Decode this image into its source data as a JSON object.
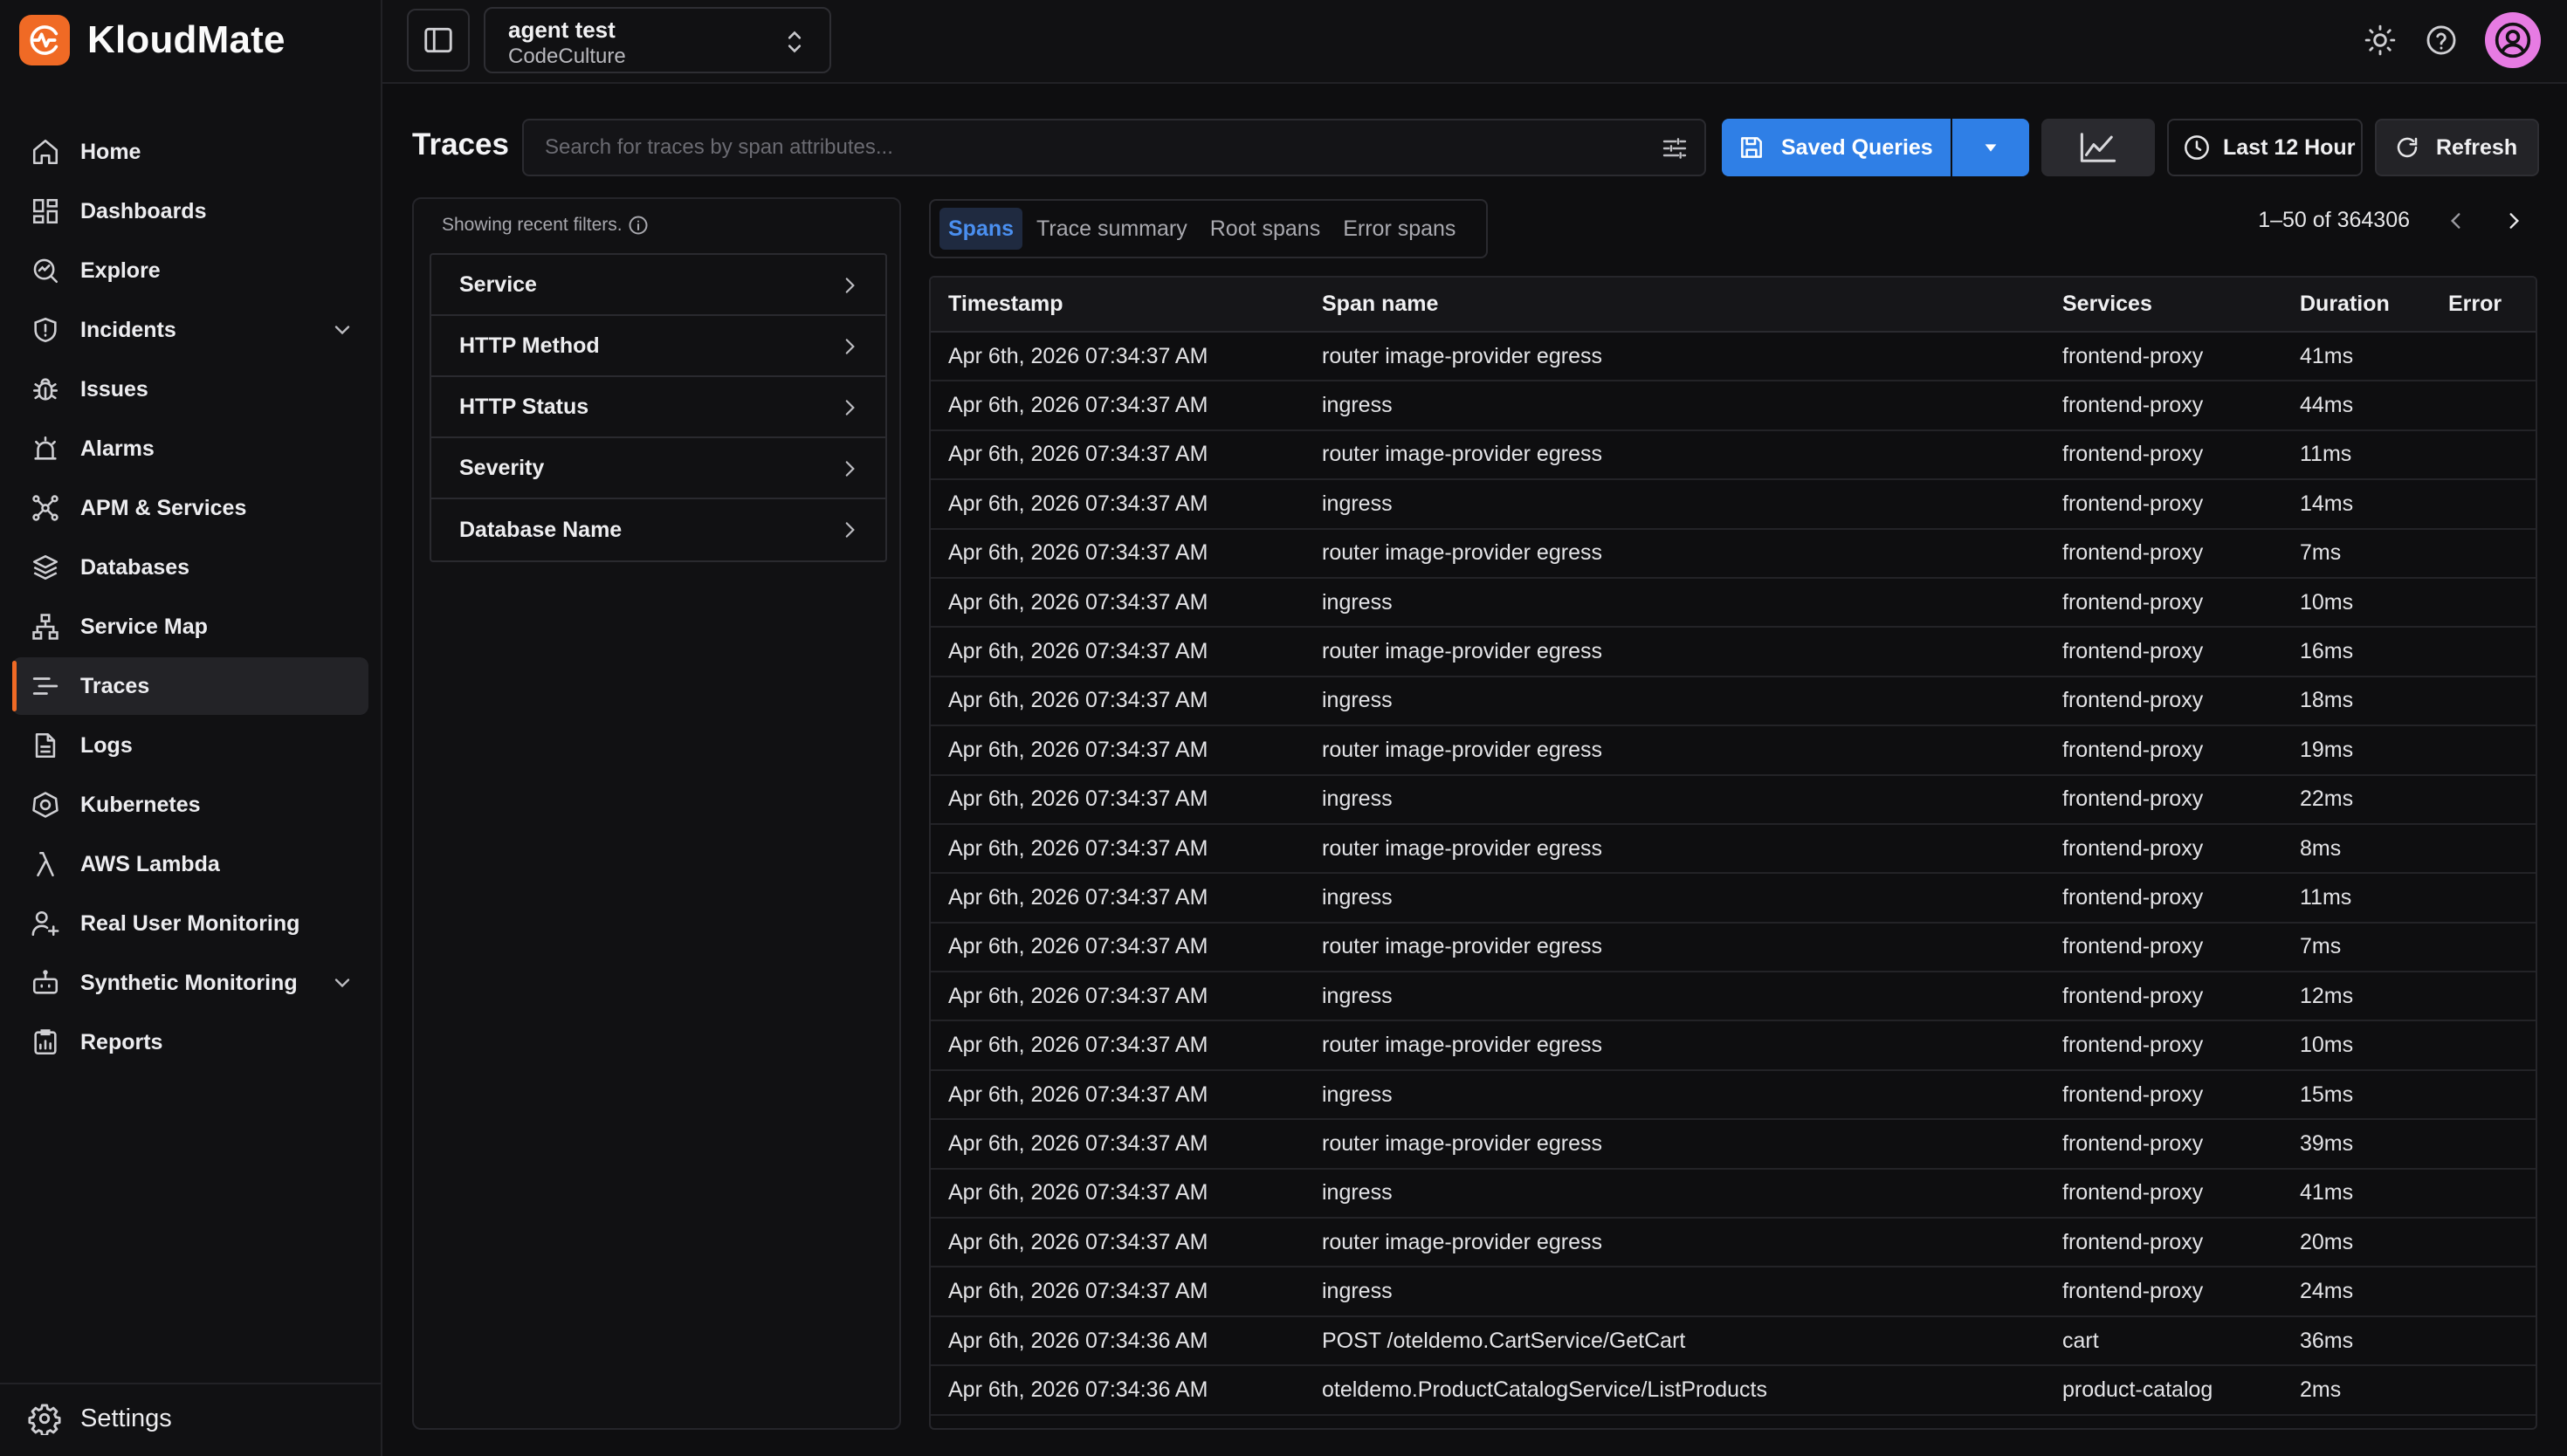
{
  "brand": {
    "name": "KloudMate",
    "accent": "#f06a25"
  },
  "sidebar": {
    "items": [
      {
        "label": "Home",
        "icon": "home-icon"
      },
      {
        "label": "Dashboards",
        "icon": "dashboard-icon"
      },
      {
        "label": "Explore",
        "icon": "explore-icon"
      },
      {
        "label": "Incidents",
        "icon": "shield-icon",
        "expandable": true
      },
      {
        "label": "Issues",
        "icon": "bug-icon"
      },
      {
        "label": "Alarms",
        "icon": "alarm-icon"
      },
      {
        "label": "APM & Services",
        "icon": "apm-icon"
      },
      {
        "label": "Databases",
        "icon": "database-icon"
      },
      {
        "label": "Service Map",
        "icon": "service-map-icon"
      },
      {
        "label": "Traces",
        "icon": "traces-icon",
        "active": true
      },
      {
        "label": "Logs",
        "icon": "logs-icon"
      },
      {
        "label": "Kubernetes",
        "icon": "kubernetes-icon"
      },
      {
        "label": "AWS Lambda",
        "icon": "lambda-icon"
      },
      {
        "label": "Real User Monitoring",
        "icon": "user-monitor-icon"
      },
      {
        "label": "Synthetic Monitoring",
        "icon": "robot-icon",
        "expandable": true
      },
      {
        "label": "Reports",
        "icon": "reports-icon"
      }
    ],
    "settings_label": "Settings"
  },
  "topbar": {
    "workspace_name": "agent test",
    "workspace_org": "CodeCulture"
  },
  "toolbar": {
    "title": "Traces",
    "search_placeholder": "Search for traces by span attributes...",
    "saved_queries_label": "Saved Queries",
    "time_range_label": "Last 12 Hour",
    "refresh_label": "Refresh",
    "primary_color": "#2f7fe6"
  },
  "filters": {
    "note": "Showing recent filters.",
    "items": [
      "Service",
      "HTTP Method",
      "HTTP Status",
      "Severity",
      "Database Name"
    ]
  },
  "results": {
    "tabs": [
      {
        "label": "Spans",
        "active": true
      },
      {
        "label": "Trace summary"
      },
      {
        "label": "Root spans"
      },
      {
        "label": "Error spans"
      }
    ],
    "pagination": "1–50 of 364306",
    "columns": [
      "Timestamp",
      "Span name",
      "Services",
      "Duration",
      "Error"
    ],
    "rows": [
      [
        "Apr 6th, 2026 07:34:37 AM",
        "router image-provider egress",
        "frontend-proxy",
        "41ms",
        ""
      ],
      [
        "Apr 6th, 2026 07:34:37 AM",
        "ingress",
        "frontend-proxy",
        "44ms",
        ""
      ],
      [
        "Apr 6th, 2026 07:34:37 AM",
        "router image-provider egress",
        "frontend-proxy",
        "11ms",
        ""
      ],
      [
        "Apr 6th, 2026 07:34:37 AM",
        "ingress",
        "frontend-proxy",
        "14ms",
        ""
      ],
      [
        "Apr 6th, 2026 07:34:37 AM",
        "router image-provider egress",
        "frontend-proxy",
        "7ms",
        ""
      ],
      [
        "Apr 6th, 2026 07:34:37 AM",
        "ingress",
        "frontend-proxy",
        "10ms",
        ""
      ],
      [
        "Apr 6th, 2026 07:34:37 AM",
        "router image-provider egress",
        "frontend-proxy",
        "16ms",
        ""
      ],
      [
        "Apr 6th, 2026 07:34:37 AM",
        "ingress",
        "frontend-proxy",
        "18ms",
        ""
      ],
      [
        "Apr 6th, 2026 07:34:37 AM",
        "router image-provider egress",
        "frontend-proxy",
        "19ms",
        ""
      ],
      [
        "Apr 6th, 2026 07:34:37 AM",
        "ingress",
        "frontend-proxy",
        "22ms",
        ""
      ],
      [
        "Apr 6th, 2026 07:34:37 AM",
        "router image-provider egress",
        "frontend-proxy",
        "8ms",
        ""
      ],
      [
        "Apr 6th, 2026 07:34:37 AM",
        "ingress",
        "frontend-proxy",
        "11ms",
        ""
      ],
      [
        "Apr 6th, 2026 07:34:37 AM",
        "router image-provider egress",
        "frontend-proxy",
        "7ms",
        ""
      ],
      [
        "Apr 6th, 2026 07:34:37 AM",
        "ingress",
        "frontend-proxy",
        "12ms",
        ""
      ],
      [
        "Apr 6th, 2026 07:34:37 AM",
        "router image-provider egress",
        "frontend-proxy",
        "10ms",
        ""
      ],
      [
        "Apr 6th, 2026 07:34:37 AM",
        "ingress",
        "frontend-proxy",
        "15ms",
        ""
      ],
      [
        "Apr 6th, 2026 07:34:37 AM",
        "router image-provider egress",
        "frontend-proxy",
        "39ms",
        ""
      ],
      [
        "Apr 6th, 2026 07:34:37 AM",
        "ingress",
        "frontend-proxy",
        "41ms",
        ""
      ],
      [
        "Apr 6th, 2026 07:34:37 AM",
        "router image-provider egress",
        "frontend-proxy",
        "20ms",
        ""
      ],
      [
        "Apr 6th, 2026 07:34:37 AM",
        "ingress",
        "frontend-proxy",
        "24ms",
        ""
      ],
      [
        "Apr 6th, 2026 07:34:36 AM",
        "POST /oteldemo.CartService/GetCart",
        "cart",
        "36ms",
        ""
      ],
      [
        "Apr 6th, 2026 07:34:36 AM",
        "oteldemo.ProductCatalogService/ListProducts",
        "product-catalog",
        "2ms",
        ""
      ]
    ]
  }
}
